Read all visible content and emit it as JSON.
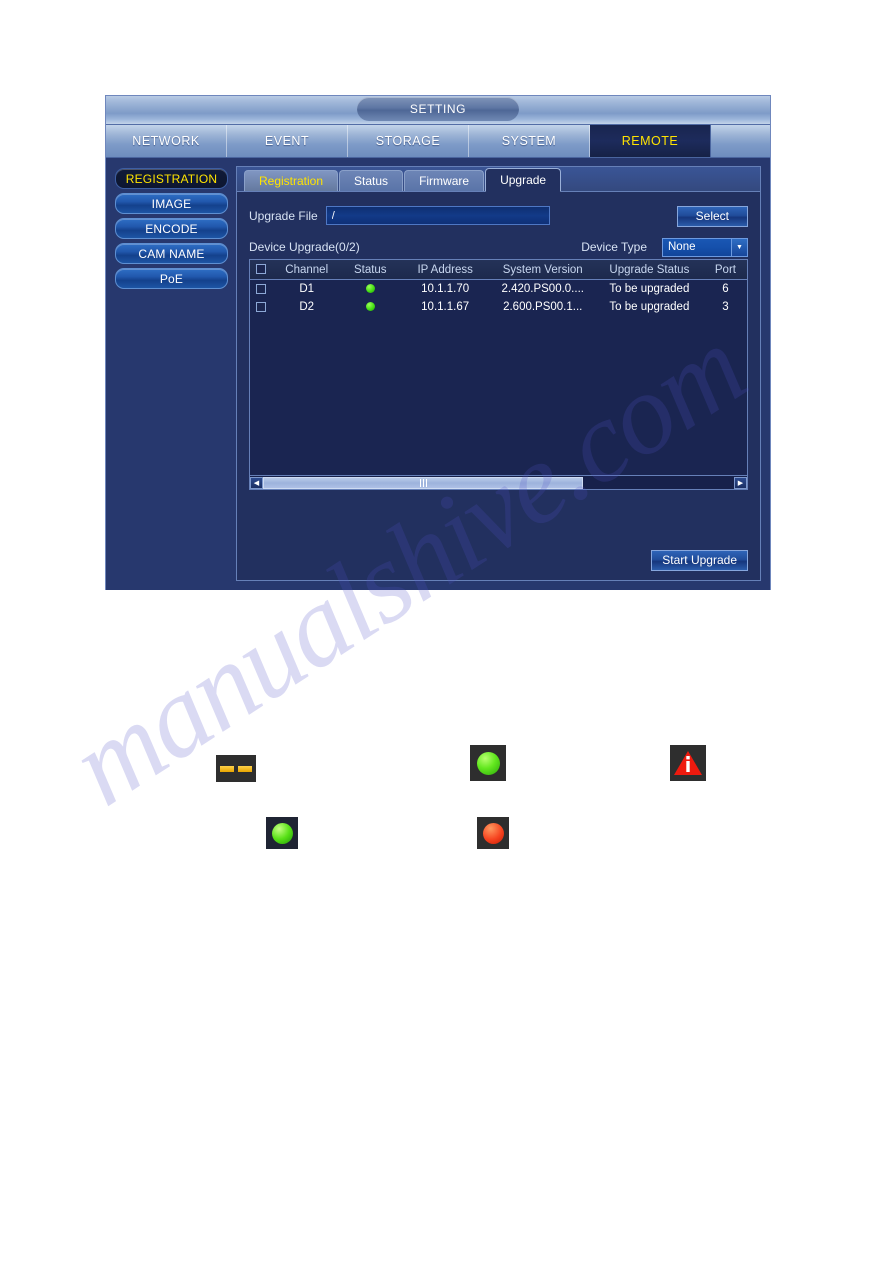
{
  "window": {
    "title": "SETTING"
  },
  "main_nav": {
    "tabs": [
      {
        "label": "NETWORK",
        "active": false
      },
      {
        "label": "EVENT",
        "active": false
      },
      {
        "label": "STORAGE",
        "active": false
      },
      {
        "label": "SYSTEM",
        "active": false
      },
      {
        "label": "REMOTE",
        "active": true
      }
    ]
  },
  "sidebar": {
    "items": [
      {
        "label": "REGISTRATION",
        "active": true
      },
      {
        "label": "IMAGE",
        "active": false
      },
      {
        "label": "ENCODE",
        "active": false
      },
      {
        "label": "CAM NAME",
        "active": false
      },
      {
        "label": "PoE",
        "active": false
      }
    ]
  },
  "sub_tabs": [
    {
      "label": "Registration",
      "state": "highlight"
    },
    {
      "label": "Status",
      "state": "normal"
    },
    {
      "label": "Firmware",
      "state": "normal"
    },
    {
      "label": "Upgrade",
      "state": "active"
    }
  ],
  "upgrade_panel": {
    "file_label": "Upgrade File",
    "file_value": "/",
    "file_placeholder": "/",
    "select_button": "Select",
    "device_upgrade_label": "Device Upgrade(0/2)",
    "device_type_label": "Device Type",
    "device_type_value": "None",
    "start_button": "Start Upgrade"
  },
  "table": {
    "columns": [
      "Channel",
      "Status",
      "IP Address",
      "System Version",
      "Upgrade Status",
      "Port"
    ],
    "rows": [
      {
        "checked": false,
        "channel": "D1",
        "status": "online",
        "ip": "10.1.1.70",
        "version": "2.420.PS00.0....",
        "upgrade_status": "To be upgraded",
        "port": "6"
      },
      {
        "checked": false,
        "channel": "D2",
        "status": "online",
        "ip": "10.1.1.67",
        "version": "2.600.PS00.1...",
        "upgrade_status": "To be upgraded",
        "port": "3"
      }
    ]
  },
  "legend_icons": [
    {
      "name": "dashes-icon"
    },
    {
      "name": "green-status-icon"
    },
    {
      "name": "warning-triangle-icon"
    },
    {
      "name": "green-record-icon"
    },
    {
      "name": "red-alarm-icon"
    }
  ],
  "watermark": {
    "text": "manualshive.com"
  },
  "colors": {
    "accent_yellow": "#ffe400",
    "panel_bg": "#22305f",
    "window_bg": "#27386e",
    "status_green": "#44dd14",
    "alarm_red": "#f6431f"
  }
}
